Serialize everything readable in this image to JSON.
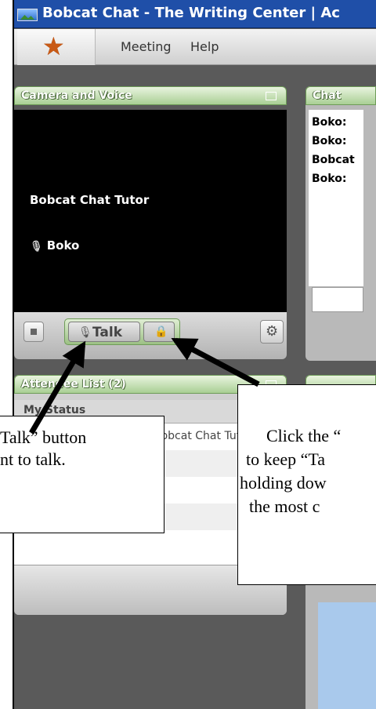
{
  "window": {
    "title": "Bobcat Chat - The Writing Center | Ac"
  },
  "menu": {
    "items": [
      "Meeting",
      "Help"
    ]
  },
  "camera_panel": {
    "title": "Camera and Voice",
    "tutor_label": "Bobcat Chat Tutor",
    "speaker_label": "Boko",
    "talk_label": "Talk"
  },
  "chat_panel": {
    "title": "Chat",
    "lines": [
      "Boko:",
      "Boko:",
      "Bobcat",
      "Boko:"
    ]
  },
  "attendee_panel": {
    "title": "Attendee List (2)",
    "status_header": "My Status",
    "attendee_name": "Bobcat Chat Tutor"
  },
  "callouts": {
    "left": [
      "Talk” button",
      "nt to talk."
    ],
    "right": [
      "Click the “",
      "to keep “Ta",
      "holding dow",
      "the most c"
    ]
  }
}
